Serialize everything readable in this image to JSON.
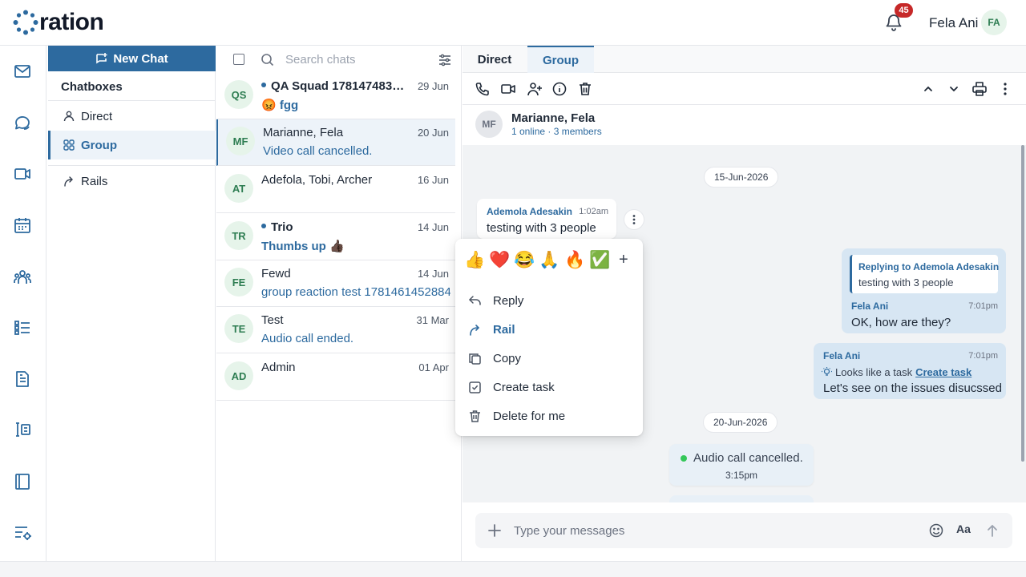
{
  "app": {
    "logo_text": "ration",
    "notification_count": "45",
    "user_name": "Fela Ani",
    "user_initials": "FA"
  },
  "rail": {
    "icons": [
      "mail-icon",
      "chat-icon",
      "video-icon",
      "calendar-icon",
      "people-icon",
      "tasks-icon",
      "document-icon",
      "board-icon",
      "notebook-icon",
      "settings-list-icon"
    ]
  },
  "chatboxes": {
    "new_chat_label": "New Chat",
    "title": "Chatboxes",
    "items": [
      {
        "label": "Direct",
        "icon": "person-icon"
      },
      {
        "label": "Group",
        "icon": "group-icon"
      },
      {
        "label": "Rails",
        "icon": "rail-icon"
      }
    ]
  },
  "chat_list": {
    "search_placeholder": "Search chats",
    "chats": [
      {
        "initials": "QS",
        "name": "QA Squad 1781474834...",
        "date": "29 Jun",
        "preview": "😡 fgg",
        "unread": true
      },
      {
        "initials": "MF",
        "name": "Marianne, Fela",
        "date": "20 Jun",
        "preview": "Video call cancelled.",
        "unread": false
      },
      {
        "initials": "AT",
        "name": "Adefola, Tobi, Archer",
        "date": "16 Jun",
        "preview": "",
        "unread": false
      },
      {
        "initials": "TR",
        "name": "Trio",
        "date": "14 Jun",
        "preview": "Thumbs up 👍🏿",
        "unread": true
      },
      {
        "initials": "FE",
        "name": "Fewd",
        "date": "14 Jun",
        "preview": "group reaction test 1781461452884",
        "unread": false
      },
      {
        "initials": "TE",
        "name": "Test",
        "date": "31 Mar",
        "preview": "Audio call ended.",
        "unread": false
      },
      {
        "initials": "AD",
        "name": "Admin",
        "date": "01 Apr",
        "preview": "",
        "unread": false
      }
    ]
  },
  "conversation": {
    "tabs": [
      "Direct",
      "Group"
    ],
    "header": {
      "initials": "MF",
      "title": "Marianne, Fela",
      "subtitle": "1 online · 3 members"
    },
    "messages": {
      "date1": "15-Jun-2026",
      "incoming": {
        "sender": "Ademola Adesakin",
        "time": "1:02am",
        "text": "testing with 3 people"
      },
      "outgoing1": {
        "reply_label": "Replying to Ademola Adesakin",
        "reply_text": "testing with 3 people",
        "sender": "Fela Ani",
        "time": "7:01pm",
        "text": "OK, how are they?"
      },
      "outgoing2": {
        "sender": "Fela Ani",
        "time": "7:01pm",
        "task_hint": "Looks like a task",
        "task_link": "Create task",
        "text": "Let's see on the issues disucssed"
      },
      "date2": "20-Jun-2026",
      "call": {
        "text": "Audio call cancelled.",
        "time": "3:15pm"
      }
    },
    "composer": {
      "placeholder": "Type your messages",
      "format_label": "Aa"
    }
  },
  "context_menu": {
    "reactions": [
      "👍",
      "❤️",
      "😂",
      "🙏",
      "🔥",
      "✅"
    ],
    "reaction_add": "+",
    "items": [
      {
        "label": "Reply",
        "icon": "reply-icon"
      },
      {
        "label": "Rail",
        "icon": "rail-icon"
      },
      {
        "label": "Copy",
        "icon": "copy-icon"
      },
      {
        "label": "Create task",
        "icon": "task-check-icon"
      },
      {
        "label": "Delete for me",
        "icon": "trash-icon"
      }
    ]
  },
  "colors": {
    "accent": "#2d6a9f",
    "avatar_bg": "#e6f4ea",
    "badge": "#c62828",
    "online": "#34c759"
  }
}
